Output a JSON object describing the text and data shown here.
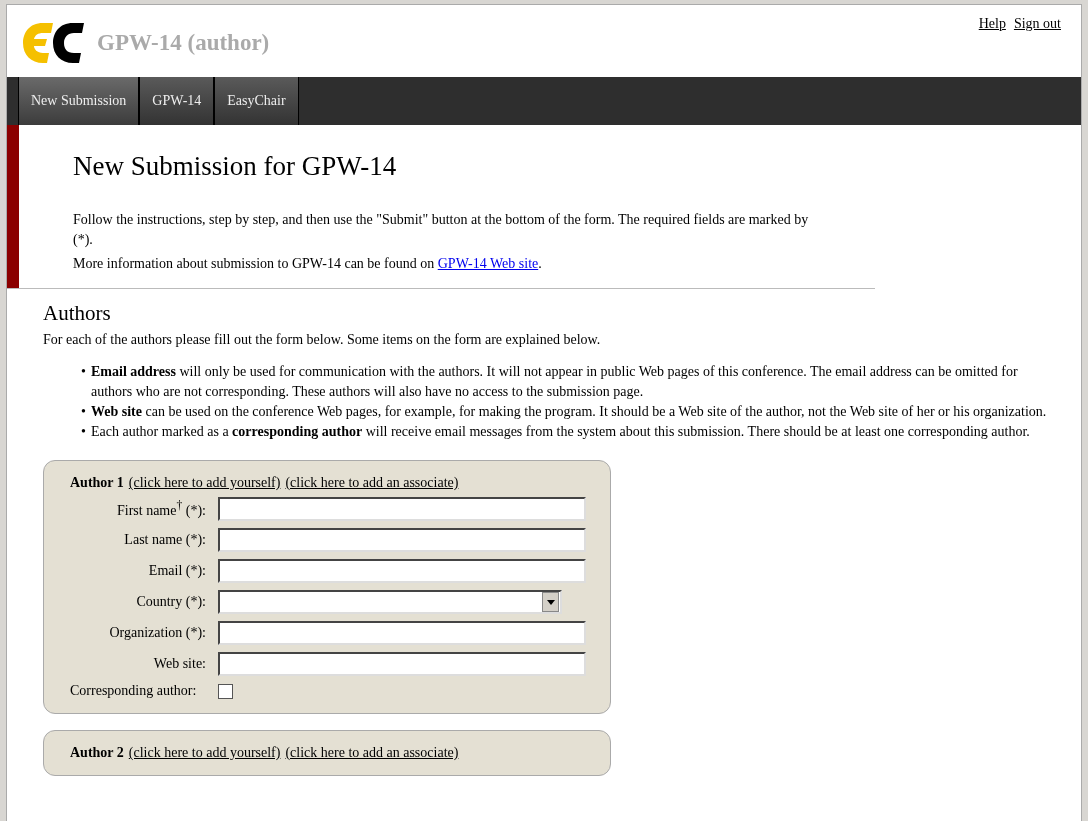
{
  "header": {
    "title": "GPW-14 (author)",
    "links": [
      "Help",
      "Sign out"
    ]
  },
  "nav": [
    {
      "label": "New Submission",
      "selected": true
    },
    {
      "label": "GPW-14",
      "selected": false
    },
    {
      "label": "EasyChair",
      "selected": false
    }
  ],
  "intro": {
    "title": "New Submission for GPW-14",
    "text": "Follow the instructions, step by step, and then use the \"Submit\" button at the bottom of the form. The required fields are marked by (*).",
    "more_text": "More information about submission to GPW-14 can be found on",
    "more_link": "GPW-14 Web site",
    "more_end": "."
  },
  "authors_section": {
    "heading": "Authors",
    "lead": "For each of the authors please fill out the form below. Some items on the form are explained below.",
    "bullets": [
      {
        "marker": "•",
        "text": "**Email address** will only be used for communication with the authors. It will not appear in public Web pages of this conference. The email address can be omitted for authors who are not corresponding. These authors will also have no access to the submission page."
      },
      {
        "marker": "•",
        "text": "**Web site** can be used on the conference Web pages, for example, for making the program. It should be a Web site of the author, not the Web site of her or his organization."
      },
      {
        "marker": "•",
        "text": "Each author marked as a **corresponding author** will receive email messages from the system about this submission. There should be at least one corresponding author."
      }
    ]
  },
  "author_forms": [
    {
      "title": "Author 1",
      "links": [
        "(click here to add yourself)",
        "(click here to add an associate)"
      ],
      "fields": [
        {
          "kind": "text",
          "label": "First name$^{†}$ (*):"
        },
        {
          "kind": "text",
          "label": "Last name (*):"
        },
        {
          "kind": "text",
          "label": "Email (*):"
        },
        {
          "kind": "select",
          "label": "Country (*):"
        },
        {
          "kind": "text",
          "label": "Organization (*):"
        },
        {
          "kind": "text",
          "label": "Web site:"
        },
        {
          "kind": "checkbox",
          "label": "Corresponding author:",
          "checked": false
        }
      ]
    },
    {
      "title": "Author 2",
      "links": [
        "(click here to add yourself)",
        "(click here to add an associate)"
      ]
    }
  ]
}
